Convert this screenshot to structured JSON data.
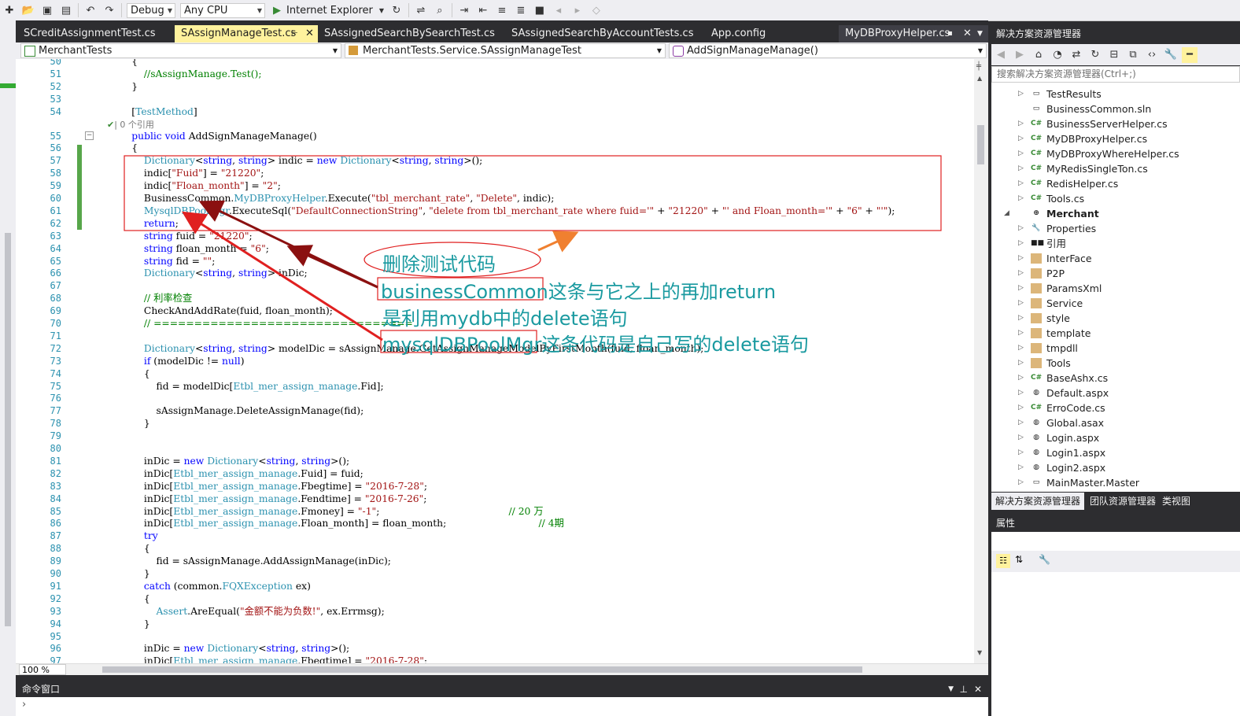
{
  "toolbar": {
    "config": "Debug",
    "platform": "Any CPU",
    "run_target": "Internet Explorer"
  },
  "tabs": [
    {
      "label": "SCreditAssignmentTest.cs",
      "active": false
    },
    {
      "label": "SAssignManageTest.cs",
      "active": true
    },
    {
      "label": "SAssignedSearchBySearchTest.cs",
      "active": false
    },
    {
      "label": "SAssignedSearchByAccountTests.cs",
      "active": false
    },
    {
      "label": "App.config",
      "active": false
    },
    {
      "label": "MyDBProxyHelper.cs",
      "active": false
    }
  ],
  "navbar": {
    "project": "MerchantTests",
    "class": "MerchantTests.Service.SAssignManageTest",
    "member": "AddSignManageManage()"
  },
  "editor": {
    "zoom": "100 %",
    "codelens": "0 个引用",
    "lines": [
      {
        "n": "50",
        "t": "        {"
      },
      {
        "n": "51",
        "t": "            //sAssignManage.Test();"
      },
      {
        "n": "52",
        "t": "        }"
      },
      {
        "n": "53",
        "t": ""
      },
      {
        "n": "54",
        "t": "        [TestMethod]"
      },
      {
        "n": "55",
        "t": "        public void AddSignManageManage()"
      },
      {
        "n": "56",
        "t": "        {"
      },
      {
        "n": "57",
        "t": "            Dictionary<string, string> indic = new Dictionary<string, string>();"
      },
      {
        "n": "58",
        "t": "            indic[\"Fuid\"] = \"21220\";"
      },
      {
        "n": "59",
        "t": "            indic[\"Floan_month\"] = \"2\";"
      },
      {
        "n": "60",
        "t": "            BusinessCommon.MyDBProxyHelper.Execute(\"tbl_merchant_rate\", \"Delete\", indic);"
      },
      {
        "n": "61",
        "t": "            MysqlDBPoolMgr.ExecuteSql(\"DefaultConnectionString\", \"delete from tbl_merchant_rate where fuid='\" + \"21220\" + \"' and Floan_month='\" + \"6\" + \"'\");"
      },
      {
        "n": "62",
        "t": "            return;"
      },
      {
        "n": "63",
        "t": "            string fuid = \"21220\";"
      },
      {
        "n": "64",
        "t": "            string floan_month = \"6\";"
      },
      {
        "n": "65",
        "t": "            string fid = \"\";"
      },
      {
        "n": "66",
        "t": "            Dictionary<string, string> inDic;"
      },
      {
        "n": "67",
        "t": ""
      },
      {
        "n": "68",
        "t": "            // 利率检查"
      },
      {
        "n": "69",
        "t": "            CheckAndAddRate(fuid, floan_month);"
      },
      {
        "n": "70",
        "t": "            // ================================"
      },
      {
        "n": "71",
        "t": ""
      },
      {
        "n": "72",
        "t": "            Dictionary<string, string> modelDic = sAssignManage.GetAssignManageModelByFirstMonth(fuid, floan_month);"
      },
      {
        "n": "73",
        "t": "            if (modelDic != null)"
      },
      {
        "n": "74",
        "t": "            {"
      },
      {
        "n": "75",
        "t": "                fid = modelDic[Etbl_mer_assign_manage.Fid];"
      },
      {
        "n": "76",
        "t": ""
      },
      {
        "n": "77",
        "t": "                sAssignManage.DeleteAssignManage(fid);"
      },
      {
        "n": "78",
        "t": "            }"
      },
      {
        "n": "79",
        "t": ""
      },
      {
        "n": "80",
        "t": ""
      },
      {
        "n": "81",
        "t": "            inDic = new Dictionary<string, string>();"
      },
      {
        "n": "82",
        "t": "            inDic[Etbl_mer_assign_manage.Fuid] = fuid;"
      },
      {
        "n": "83",
        "t": "            inDic[Etbl_mer_assign_manage.Fbegtime] = \"2016-7-28\";"
      },
      {
        "n": "84",
        "t": "            inDic[Etbl_mer_assign_manage.Fendtime] = \"2016-7-26\";"
      },
      {
        "n": "85",
        "t": "            inDic[Etbl_mer_assign_manage.Fmoney] = \"-1\";                                          // 20 万"
      },
      {
        "n": "86",
        "t": "            inDic[Etbl_mer_assign_manage.Floan_month] = floan_month;                              // 4期"
      },
      {
        "n": "87",
        "t": "            try"
      },
      {
        "n": "88",
        "t": "            {"
      },
      {
        "n": "89",
        "t": "                fid = sAssignManage.AddAssignManage(inDic);"
      },
      {
        "n": "90",
        "t": "            }"
      },
      {
        "n": "91",
        "t": "            catch (common.FQXException ex)"
      },
      {
        "n": "92",
        "t": "            {"
      },
      {
        "n": "93",
        "t": "                Assert.AreEqual(\"金额不能为负数!\", ex.Errmsg);"
      },
      {
        "n": "94",
        "t": "            }"
      },
      {
        "n": "95",
        "t": ""
      },
      {
        "n": "96",
        "t": "            inDic = new Dictionary<string, string>();"
      },
      {
        "n": "97",
        "t": "            inDic[Etbl_mer_assign_manage.Fbegtime] = \"2016-7-28\";"
      }
    ]
  },
  "annotations": {
    "delete_test_code": "删除测试代码",
    "line1_a": "businessCommon",
    "line1_b": "这条与它之上的再加return",
    "line2": "是利用mydb中的delete语句",
    "line3_a": "mysqlDBPoolMgr",
    "line3_b": "这条代码是自己写的delete语句"
  },
  "command_window": {
    "title": "命令窗口"
  },
  "solution_explorer": {
    "title": "解决方案资源管理器",
    "search_placeholder": "搜索解决方案资源管理器(Ctrl+;)",
    "items": [
      {
        "label": "TestResults",
        "kind": "generic",
        "level": 1,
        "expand": true
      },
      {
        "label": "BusinessCommon.sln",
        "kind": "generic",
        "level": 1,
        "expand": false
      },
      {
        "label": "BusinessServerHelper.cs",
        "kind": "cs",
        "level": 1,
        "expand": true
      },
      {
        "label": "MyDBProxyHelper.cs",
        "kind": "cs",
        "level": 1,
        "expand": true
      },
      {
        "label": "MyDBProxyWhereHelper.cs",
        "kind": "cs",
        "level": 1,
        "expand": true
      },
      {
        "label": "MyRedisSingleTon.cs",
        "kind": "cs",
        "level": 1,
        "expand": true
      },
      {
        "label": "RedisHelper.cs",
        "kind": "cs",
        "level": 1,
        "expand": true
      },
      {
        "label": "Tools.cs",
        "kind": "cs",
        "level": 1,
        "expand": true
      },
      {
        "label": "Merchant",
        "kind": "project",
        "level": 0,
        "expand": true
      },
      {
        "label": "Properties",
        "kind": "wrench",
        "level": 1,
        "expand": true
      },
      {
        "label": "引用",
        "kind": "ref",
        "level": 1,
        "expand": true
      },
      {
        "label": "InterFace",
        "kind": "folder",
        "level": 1,
        "expand": true
      },
      {
        "label": "P2P",
        "kind": "folder",
        "level": 1,
        "expand": true
      },
      {
        "label": "ParamsXml",
        "kind": "folder",
        "level": 1,
        "expand": true
      },
      {
        "label": "Service",
        "kind": "folder",
        "level": 1,
        "expand": true
      },
      {
        "label": "style",
        "kind": "folder",
        "level": 1,
        "expand": true
      },
      {
        "label": "template",
        "kind": "folder",
        "level": 1,
        "expand": true
      },
      {
        "label": "tmpdll",
        "kind": "folder",
        "level": 1,
        "expand": true
      },
      {
        "label": "Tools",
        "kind": "folder",
        "level": 1,
        "expand": true
      },
      {
        "label": "BaseAshx.cs",
        "kind": "cs",
        "level": 1,
        "expand": true
      },
      {
        "label": "Default.aspx",
        "kind": "web",
        "level": 1,
        "expand": true
      },
      {
        "label": "ErroCode.cs",
        "kind": "cs",
        "level": 1,
        "expand": true
      },
      {
        "label": "Global.asax",
        "kind": "web",
        "level": 1,
        "expand": true
      },
      {
        "label": "Login.aspx",
        "kind": "web",
        "level": 1,
        "expand": true
      },
      {
        "label": "Login1.aspx",
        "kind": "web",
        "level": 1,
        "expand": true
      },
      {
        "label": "Login2.aspx",
        "kind": "web",
        "level": 1,
        "expand": true
      },
      {
        "label": "MainMaster.Master",
        "kind": "generic",
        "level": 1,
        "expand": true
      }
    ],
    "bottom_tabs": [
      {
        "label": "解决方案资源管理器",
        "active": true
      },
      {
        "label": "团队资源管理器",
        "active": false
      },
      {
        "label": "类视图",
        "active": false
      }
    ]
  },
  "properties": {
    "title": "属性"
  },
  "colors": {
    "annotation_red": "#e02020",
    "arrow_dark": "#8b1010",
    "arrow_orange": "#f08030",
    "callout_teal": "#1a9aa0"
  }
}
